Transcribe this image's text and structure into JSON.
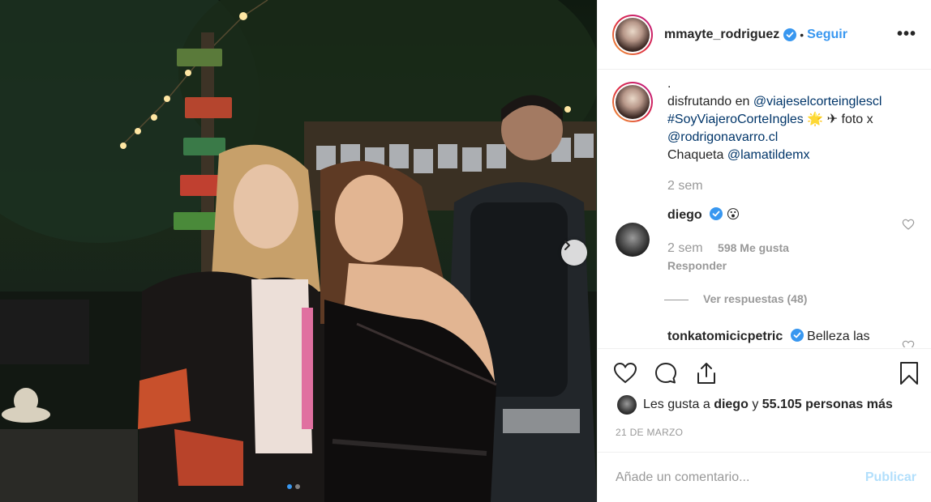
{
  "post": {
    "username": "mmayte_rodriguez",
    "separator": "•",
    "follow_label": "Seguir",
    "more_label": "•••",
    "carousel": {
      "total": 2,
      "current": 1
    }
  },
  "caption": {
    "line0": ".",
    "text_prefix": "disfrutando en ",
    "mention_store": "@viajeselcorteinglescl",
    "hashtag": "#SoyViajeroCorteIngles",
    "emoji_star": "🌟",
    "emoji_plane": "✈",
    "photo_text": " foto x",
    "mention_photo": "@rodrigonavarro.cl",
    "jacket_text": "Chaqueta ",
    "mention_jacket": "@lamatildemx",
    "time": "2 sem"
  },
  "comments": [
    {
      "username": "diego",
      "text": "😮",
      "time": "2 sem",
      "likes": "598 Me gusta",
      "reply": "Responder",
      "view_replies": "Ver respuestas (48)"
    },
    {
      "username": "tonkatomicicpetric",
      "text": "Belleza las"
    }
  ],
  "likes_bar": {
    "prefix": "Les gusta a ",
    "user": "diego",
    "middle": " y ",
    "count": "55.105 personas más"
  },
  "date": "21 DE MARZO",
  "comment_input": {
    "placeholder": "Añade un comentario...",
    "publish_label": "Publicar"
  },
  "colors": {
    "link": "#003569",
    "follow": "#3897f0",
    "verified": "#3897f0",
    "publish_disabled": "#b2dffc",
    "muted": "#999999"
  },
  "icons": [
    "verified-badge-icon",
    "heart-icon",
    "comment-icon",
    "share-icon",
    "bookmark-icon",
    "chevron-right-icon"
  ]
}
